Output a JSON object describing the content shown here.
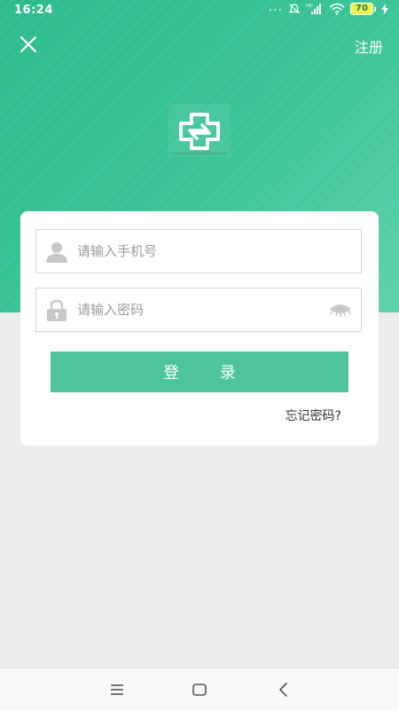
{
  "status_bar": {
    "time": "16:24",
    "dots": "...",
    "network": "HD",
    "battery": "70"
  },
  "header": {
    "register_label": "注册"
  },
  "login": {
    "phone_placeholder": "请输入手机号",
    "password_placeholder": "请输入密码",
    "login_label": "登 录",
    "forgot_label": "忘记密码?"
  },
  "colors": {
    "brand": "#3cc499",
    "button": "#4dc49a",
    "background": "#ececec"
  },
  "icons": [
    "close-icon",
    "app-logo-icon",
    "user-icon",
    "lock-icon",
    "eye-icon",
    "menu-icon",
    "home-icon",
    "back-icon",
    "wifi-icon",
    "signal-icon",
    "battery-icon",
    "mute-icon"
  ]
}
